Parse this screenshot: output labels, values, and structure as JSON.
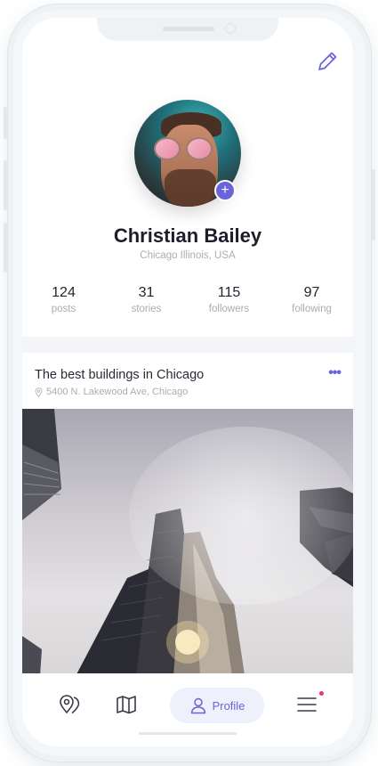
{
  "profile": {
    "name": "Christian Bailey",
    "location": "Chicago Illinois, USA",
    "stats": [
      {
        "value": "124",
        "label": "posts"
      },
      {
        "value": "31",
        "label": "stories"
      },
      {
        "value": "115",
        "label": "followers"
      },
      {
        "value": "97",
        "label": "following"
      }
    ]
  },
  "post": {
    "title": "The best buildings in Chicago",
    "location": "5400 N. Lakewood Ave, Chicago",
    "more_label": "•••"
  },
  "tabbar": {
    "items": [
      {
        "icon": "location-pin-icon"
      },
      {
        "icon": "map-icon"
      },
      {
        "icon": "profile-icon",
        "label": "Profile",
        "active": true
      },
      {
        "icon": "menu-icon",
        "has_notification": true
      }
    ]
  },
  "colors": {
    "accent": "#6a63d9",
    "notification": "#e8376a",
    "text_primary": "#1e1e2a",
    "text_muted": "#a9adb5"
  }
}
